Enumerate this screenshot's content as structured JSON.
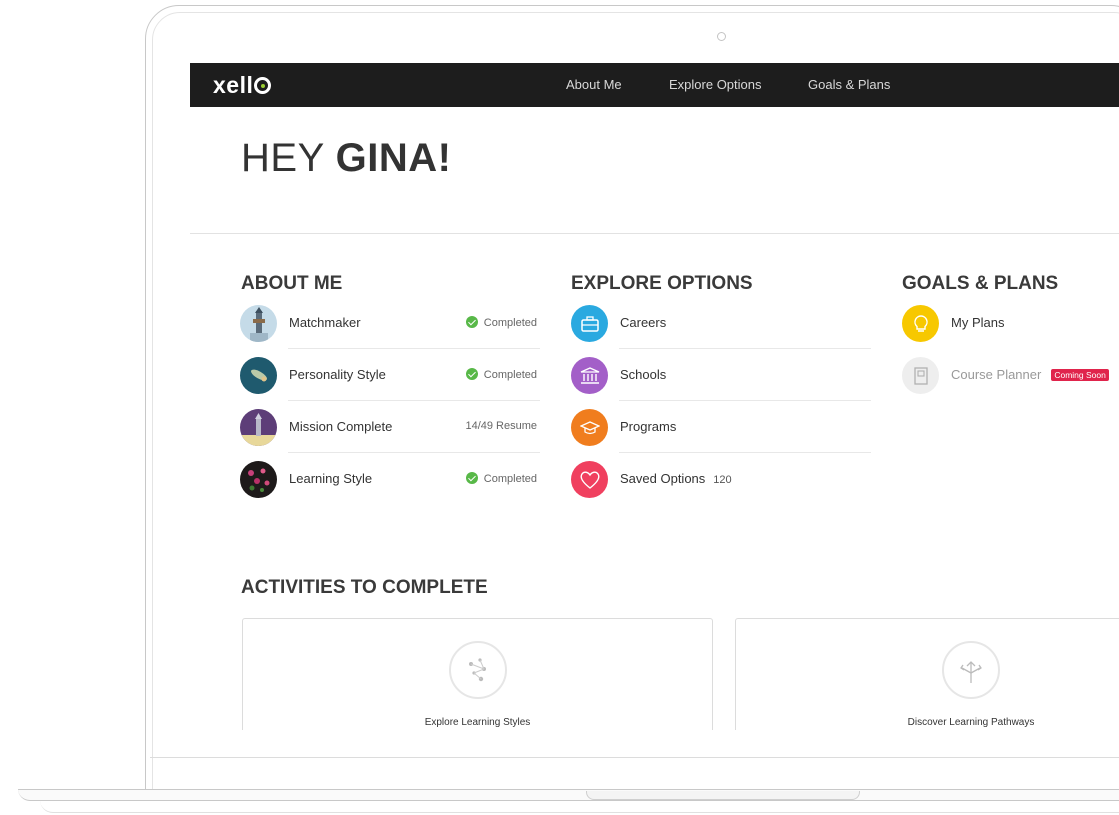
{
  "nav": {
    "logo": "xello",
    "links": [
      "About Me",
      "Explore Options",
      "Goals & Plans"
    ]
  },
  "greeting": {
    "hey": "HEY",
    "name": "GINA!"
  },
  "about_me": {
    "title": "ABOUT ME",
    "items": [
      {
        "label": "Matchmaker",
        "status": "Completed"
      },
      {
        "label": "Personality Style",
        "status": "Completed"
      },
      {
        "label": "Mission Complete",
        "status": "14/49 Resume"
      },
      {
        "label": "Learning Style",
        "status": "Completed"
      }
    ]
  },
  "explore_options": {
    "title": "EXPLORE OPTIONS",
    "items": [
      {
        "label": "Careers",
        "icon": "briefcase-icon",
        "color": "#2aa9e0"
      },
      {
        "label": "Schools",
        "icon": "building-icon",
        "color": "#a35fc8"
      },
      {
        "label": "Programs",
        "icon": "graduation-cap-icon",
        "color": "#f07d1e"
      },
      {
        "label": "Saved Options",
        "count": "120",
        "icon": "heart-icon",
        "color": "#f0405f"
      }
    ]
  },
  "goals_plans": {
    "title": "GOALS & PLANS",
    "items": [
      {
        "label": "My Plans",
        "icon": "lightbulb-icon",
        "color": "#f7c800"
      },
      {
        "label": "Course Planner",
        "badge": "Coming Soon",
        "icon": "book-icon",
        "color": "#eeeeee"
      }
    ]
  },
  "activities": {
    "title": "ACTIVITIES TO COMPLETE",
    "cards": [
      {
        "title": "Explore Learning Styles",
        "icon": "network-icon"
      },
      {
        "title": "Discover Learning Pathways",
        "icon": "arrows-split-icon"
      }
    ]
  },
  "colors": {
    "nav_bg": "#1d1d1d",
    "complete_green": "#58b848",
    "badge_red": "#e0244c"
  }
}
